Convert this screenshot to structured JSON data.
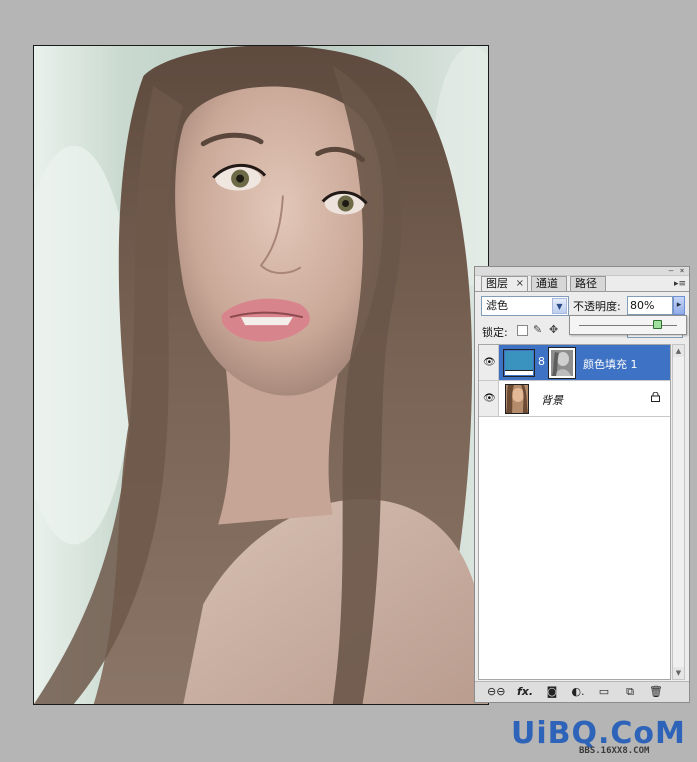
{
  "layers_panel": {
    "tabs": [
      {
        "label": "图层",
        "active": true
      },
      {
        "label": "通道",
        "active": false
      },
      {
        "label": "路径",
        "active": false
      }
    ],
    "blend_mode": "滤色",
    "opacity_label": "不透明度:",
    "opacity_value": "80%",
    "opacity_slider_fraction": 0.8,
    "lock_label": "锁定:",
    "layers": [
      {
        "name": "颜色填充 1",
        "selected": true,
        "visible": true,
        "fill_color": "#3a93be"
      },
      {
        "name": "背景",
        "selected": false,
        "visible": true,
        "locked": true
      }
    ],
    "selected_color": "#3d72c4"
  },
  "watermark": {
    "text": "UiBQ.CoM",
    "subtext": "BBS.16XX8.COM"
  }
}
